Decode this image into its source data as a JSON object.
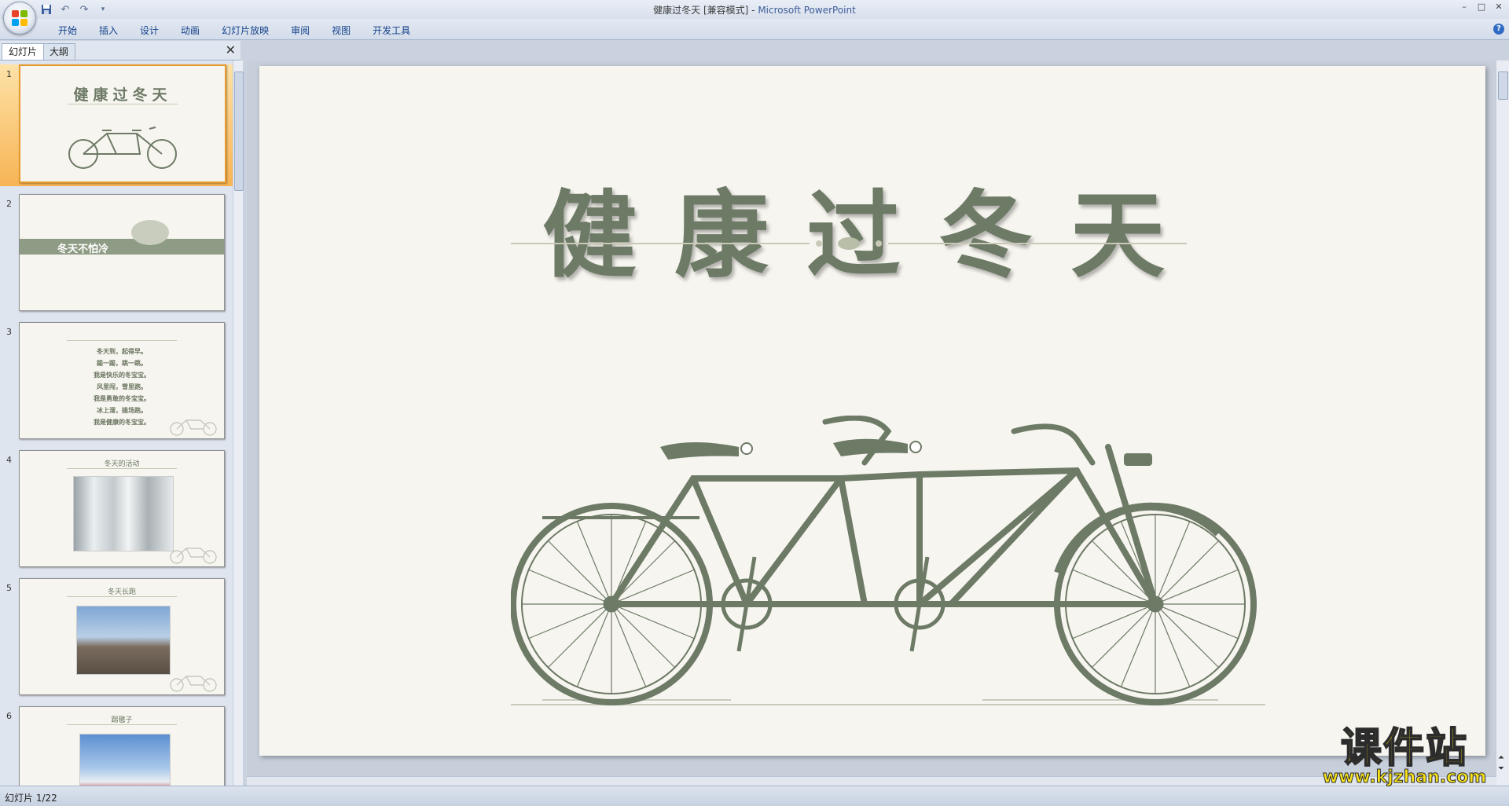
{
  "window": {
    "title_doc": "健康过冬天 [兼容模式]",
    "title_sep": " - ",
    "title_app": "Microsoft PowerPoint",
    "controls": [
      "–",
      "□",
      "✕"
    ]
  },
  "quick_access": {
    "save_icon": "save-icon",
    "undo_icon": "undo-icon",
    "redo_icon": "redo-icon"
  },
  "ribbon": {
    "tabs": [
      "开始",
      "插入",
      "设计",
      "动画",
      "幻灯片放映",
      "审阅",
      "视图",
      "开发工具"
    ],
    "help": "?"
  },
  "pane": {
    "tabs": [
      "幻灯片",
      "大纲"
    ],
    "close": "✕"
  },
  "thumbnails": [
    {
      "num": "1",
      "title": "健康过冬天",
      "selected": true
    },
    {
      "num": "2",
      "title": "冬天不怕冷"
    },
    {
      "num": "3",
      "lines": [
        "冬天到，起得早。",
        "踢一踢，跳一跳。",
        "我是快乐的冬宝宝。",
        "风里闯，雪里跑。",
        "我是勇敢的冬宝宝。",
        "冰上溜，操场跑。",
        "我是健康的冬宝宝。"
      ]
    },
    {
      "num": "4",
      "title": "冬天的活动"
    },
    {
      "num": "5",
      "title": "冬天长跑"
    },
    {
      "num": "6",
      "title": "踢毽子"
    }
  ],
  "slide": {
    "title": "健康过冬天"
  },
  "status": {
    "slide_indicator": "幻灯片 1/22"
  },
  "watermark": {
    "main": "课件站",
    "url": "www.kjzhan.com"
  },
  "colors": {
    "accent_green": "#6d7a66",
    "selection_orange": "#f8b455",
    "ribbon_text": "#15428b"
  }
}
